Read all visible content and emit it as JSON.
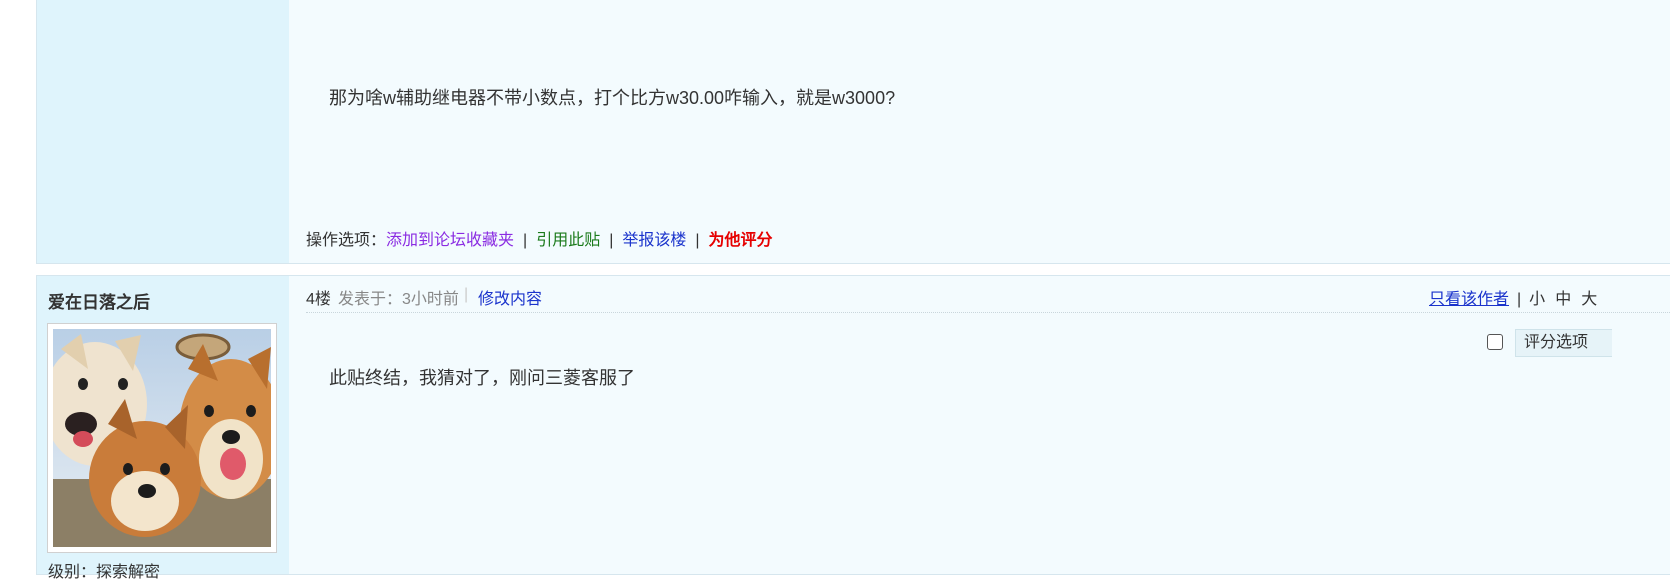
{
  "post_prev": {
    "content": "那为啥w辅助继电器不带小数点，打个比方w30.00咋输入，就是w3000?",
    "ops": {
      "label": "操作选项：",
      "add_favorite": "添加到论坛收藏夹",
      "quote": "引用此贴",
      "report": "举报该楼",
      "rate": "为他评分",
      "separator": "|"
    }
  },
  "post_4": {
    "author": "爱在日落之后",
    "avatar_icon": "shiba-dogs-avatar",
    "level_label": "级别：探索解密",
    "floor": "4楼",
    "posted": "发表于：3小时前",
    "divider": "|",
    "edit": "修改内容",
    "only_author": "只看该作者",
    "separator": "|",
    "font_sizes": [
      "小",
      "中",
      "大"
    ],
    "rate_option": "评分选项",
    "content": "此贴终结，我猜对了，刚问三菱客服了"
  }
}
